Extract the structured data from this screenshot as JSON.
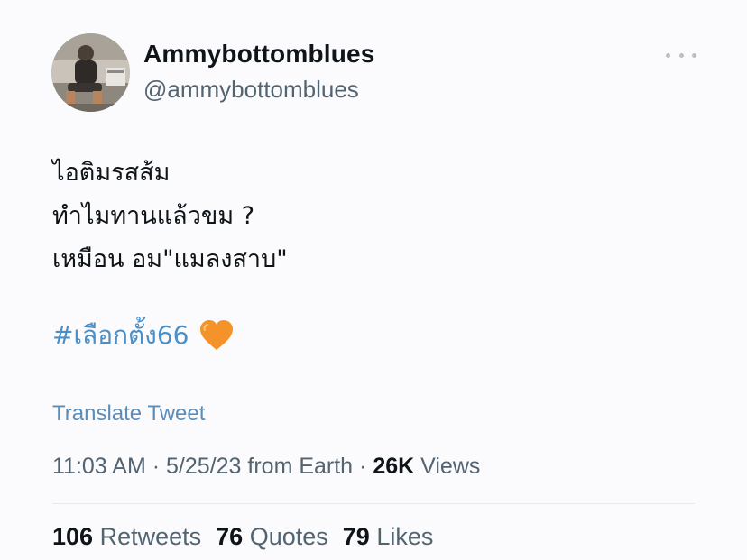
{
  "author": {
    "display_name": "Ammybottomblues",
    "handle": "@ammybottomblues"
  },
  "tweet": {
    "lines": [
      "ไอติมรสส้ม",
      "ทำไมทานแล้วขม ?",
      "เหมือน อม\"แมลงสาบ\""
    ],
    "hashtag": "#เลือกตั้ง66",
    "emoji": "orange-heart-icon",
    "translate_label": "Translate Tweet"
  },
  "meta": {
    "time": "11:03 AM",
    "separator": "·",
    "date": "5/25/23",
    "source": "from Earth",
    "views_count": "26K",
    "views_label": "Views"
  },
  "stats": {
    "retweets_count": "106",
    "retweets_label": "Retweets",
    "quotes_count": "76",
    "quotes_label": "Quotes",
    "likes_count": "79",
    "likes_label": "Likes"
  },
  "colors": {
    "link": "#4a8fc7",
    "secondary_text": "#536471",
    "primary_text": "#0f1419",
    "heart": "#f5932b"
  }
}
